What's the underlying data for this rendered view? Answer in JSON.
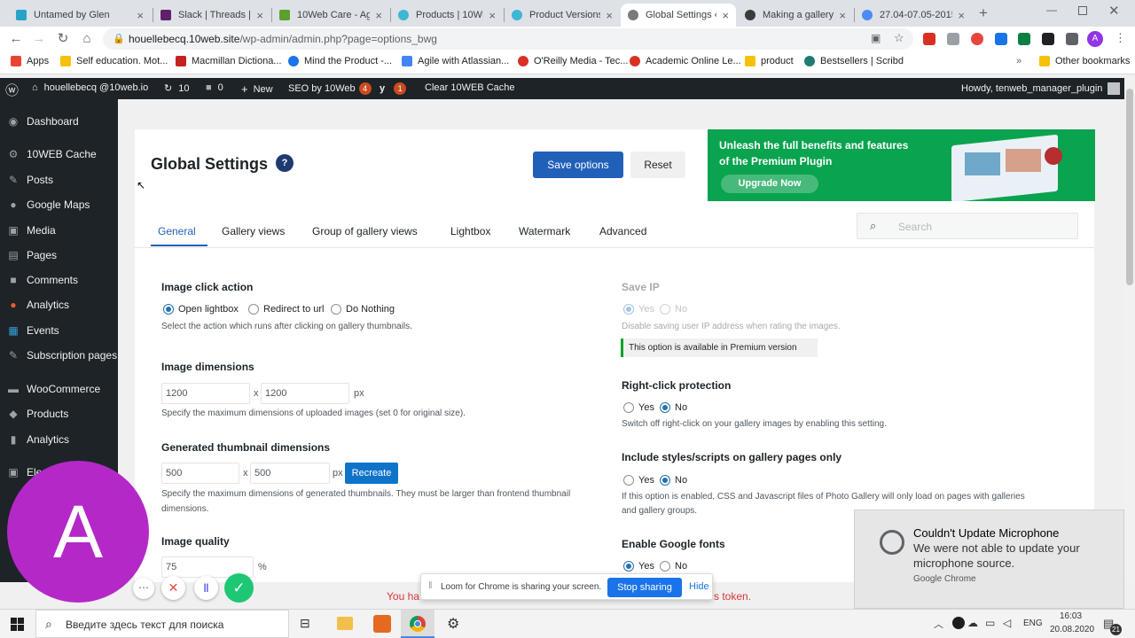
{
  "tabs": [
    {
      "title": "Untamed by Glen",
      "color": "#27a3c9"
    },
    {
      "title": "Slack | Threads |",
      "color": "#611f69"
    },
    {
      "title": "10Web Care - Ag",
      "color": "#5aa02c"
    },
    {
      "title": "Products | 10WE",
      "color": "#3fb6d3"
    },
    {
      "title": "Product Versions",
      "color": "#3fb6d3"
    },
    {
      "title": "Global Settings ‹",
      "color": "#7a7a7a"
    },
    {
      "title": "Making a gallery",
      "color": "#3c3c3c"
    },
    {
      "title": "27.04-07.05-2015",
      "color": "#4c8bf5"
    }
  ],
  "url": {
    "host": "houellebecq.10web.site",
    "path": "/wp-admin/admin.php?page=options_bwg"
  },
  "bookmarks": [
    "Apps",
    "Self education. Mot...",
    "Macmillan Dictiona...",
    "Mind the Product -...",
    "Agile with Atlassian...",
    "O'Reilly Media - Tec...",
    "Academic Online Le...",
    "product",
    "Bestsellers | Scribd",
    "Other bookmarks"
  ],
  "adminbar": {
    "site": "houellebecq @10web.io",
    "updates": "10",
    "comments": "0",
    "new": "New",
    "seo": "SEO by 10Web",
    "seo_badge": "4",
    "yoast_badge": "1",
    "cache": "Clear 10WEB Cache",
    "howdy": "Howdy, tenweb_manager_plugin"
  },
  "sidebar": [
    "Dashboard",
    "10WEB Cache",
    "Posts",
    "Google Maps",
    "Media",
    "Pages",
    "Comments",
    "Analytics",
    "Events",
    "Subscription pages",
    "WooCommerce",
    "Products",
    "Analytics",
    "Ele"
  ],
  "page": {
    "title": "Global Settings",
    "help": "?",
    "save": "Save options",
    "reset": "Reset",
    "promo_line1": "Unleash the full benefits and features",
    "promo_line2": "of the Premium Plugin",
    "upgrade": "Upgrade Now",
    "search_placeholder": "Search"
  },
  "settings_tabs": [
    "General",
    "Gallery views",
    "Group of gallery views",
    "Lightbox",
    "Watermark",
    "Advanced"
  ],
  "left": {
    "click_label": "Image click action",
    "click_opts": [
      "Open lightbox",
      "Redirect to url",
      "Do Nothing"
    ],
    "click_desc": "Select the action which runs after clicking on gallery thumbnails.",
    "dim_label": "Image dimensions",
    "dim_w": "1200",
    "dim_h": "1200",
    "dim_x": "x",
    "dim_unit": "px",
    "dim_desc": "Specify the maximum dimensions of uploaded images (set 0 for original size).",
    "thumb_label": "Generated thumbnail dimensions",
    "thumb_w": "500",
    "thumb_h": "500",
    "thumb_x": "x",
    "thumb_unit": "px",
    "recreate": "Recreate",
    "thumb_desc1": "Specify the maximum dimensions of generated thumbnails. They must be larger than frontend thumbnail",
    "thumb_desc2": "dimensions.",
    "quality_label": "Image quality",
    "quality": "75",
    "quality_unit": "%"
  },
  "right": {
    "saveip_label": "Save IP",
    "yes": "Yes",
    "no": "No",
    "saveip_desc": "Disable saving user IP address when rating the images.",
    "premium_note": "This option is available in Premium version",
    "rc_label": "Right-click protection",
    "rc_desc": "Switch off right-click on your gallery images by enabling this setting.",
    "inc_label": "Include styles/scripts on gallery pages only",
    "inc_desc1": "If this option is enabled, CSS and Javascript files of Photo Gallery will only load on pages with galleries",
    "inc_desc2": "and gallery groups.",
    "gf_label": "Enable Google fonts"
  },
  "notification": {
    "title": "Couldn't Update Microphone",
    "body1": "We were not able to update your",
    "body2": "microphone source.",
    "source": "Google Chrome"
  },
  "loom": {
    "text": "Loom for Chrome is sharing your screen.",
    "stop": "Stop sharing",
    "hide": "Hide"
  },
  "error_text_left": "You ha",
  "error_text_right": "s token.",
  "avatar_letter": "A",
  "taskbar": {
    "search": "Введите здесь текст для поиска",
    "lang": "ENG",
    "time": "16:03",
    "date": "20.08.2020",
    "notif_count": "21"
  }
}
